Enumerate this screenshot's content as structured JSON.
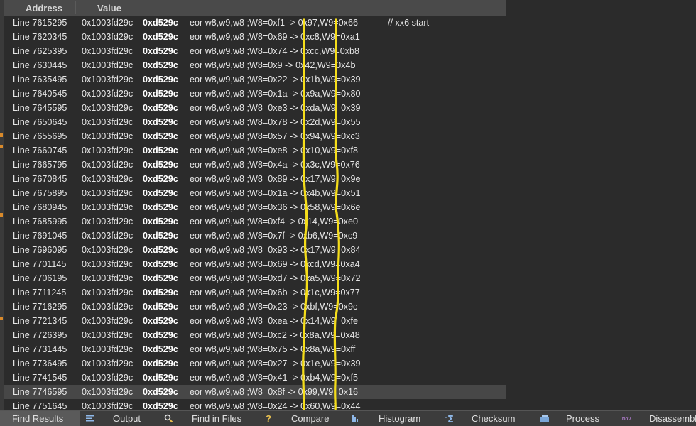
{
  "columns": {
    "address": "Address",
    "value": "Value"
  },
  "rows": [
    {
      "line": "Line 7615295",
      "addr": "0x1003fd29c",
      "val": "0xd529c",
      "ins": "eor w8,w9,w8 ;W8=0xf1 -> 0x97,W9=0x66",
      "comment": "// xx6 start"
    },
    {
      "line": "Line 7620345",
      "addr": "0x1003fd29c",
      "val": "0xd529c",
      "ins": "eor w8,w9,w8 ;W8=0x69 -> 0xc8,W9=0xa1",
      "comment": ""
    },
    {
      "line": "Line 7625395",
      "addr": "0x1003fd29c",
      "val": "0xd529c",
      "ins": "eor w8,w9,w8 ;W8=0x74 -> 0xcc,W9=0xb8",
      "comment": ""
    },
    {
      "line": "Line 7630445",
      "addr": "0x1003fd29c",
      "val": "0xd529c",
      "ins": "eor w8,w9,w8 ;W8=0x9 -> 0x42,W9=0x4b",
      "comment": ""
    },
    {
      "line": "Line 7635495",
      "addr": "0x1003fd29c",
      "val": "0xd529c",
      "ins": "eor w8,w9,w8 ;W8=0x22 -> 0x1b,W9=0x39",
      "comment": ""
    },
    {
      "line": "Line 7640545",
      "addr": "0x1003fd29c",
      "val": "0xd529c",
      "ins": "eor w8,w9,w8 ;W8=0x1a -> 0x9a,W9=0x80",
      "comment": ""
    },
    {
      "line": "Line 7645595",
      "addr": "0x1003fd29c",
      "val": "0xd529c",
      "ins": "eor w8,w9,w8 ;W8=0xe3 -> 0xda,W9=0x39",
      "comment": ""
    },
    {
      "line": "Line 7650645",
      "addr": "0x1003fd29c",
      "val": "0xd529c",
      "ins": "eor w8,w9,w8 ;W8=0x78 -> 0x2d,W9=0x55",
      "comment": ""
    },
    {
      "line": "Line 7655695",
      "addr": "0x1003fd29c",
      "val": "0xd529c",
      "ins": "eor w8,w9,w8 ;W8=0x57 -> 0x94,W9=0xc3",
      "comment": ""
    },
    {
      "line": "Line 7660745",
      "addr": "0x1003fd29c",
      "val": "0xd529c",
      "ins": "eor w8,w9,w8 ;W8=0xe8 -> 0x10,W9=0xf8",
      "comment": ""
    },
    {
      "line": "Line 7665795",
      "addr": "0x1003fd29c",
      "val": "0xd529c",
      "ins": "eor w8,w9,w8 ;W8=0x4a -> 0x3c,W9=0x76",
      "comment": ""
    },
    {
      "line": "Line 7670845",
      "addr": "0x1003fd29c",
      "val": "0xd529c",
      "ins": "eor w8,w9,w8 ;W8=0x89 -> 0x17,W9=0x9e",
      "comment": ""
    },
    {
      "line": "Line 7675895",
      "addr": "0x1003fd29c",
      "val": "0xd529c",
      "ins": "eor w8,w9,w8 ;W8=0x1a -> 0x4b,W9=0x51",
      "comment": ""
    },
    {
      "line": "Line 7680945",
      "addr": "0x1003fd29c",
      "val": "0xd529c",
      "ins": "eor w8,w9,w8 ;W8=0x36 -> 0x58,W9=0x6e",
      "comment": ""
    },
    {
      "line": "Line 7685995",
      "addr": "0x1003fd29c",
      "val": "0xd529c",
      "ins": "eor w8,w9,w8 ;W8=0xf4 -> 0x14,W9=0xe0",
      "comment": ""
    },
    {
      "line": "Line 7691045",
      "addr": "0x1003fd29c",
      "val": "0xd529c",
      "ins": "eor w8,w9,w8 ;W8=0x7f -> 0xb6,W9=0xc9",
      "comment": ""
    },
    {
      "line": "Line 7696095",
      "addr": "0x1003fd29c",
      "val": "0xd529c",
      "ins": "eor w8,w9,w8 ;W8=0x93 -> 0x17,W9=0x84",
      "comment": ""
    },
    {
      "line": "Line 7701145",
      "addr": "0x1003fd29c",
      "val": "0xd529c",
      "ins": "eor w8,w9,w8 ;W8=0x69 -> 0xcd,W9=0xa4",
      "comment": ""
    },
    {
      "line": "Line 7706195",
      "addr": "0x1003fd29c",
      "val": "0xd529c",
      "ins": "eor w8,w9,w8 ;W8=0xd7 -> 0xa5,W9=0x72",
      "comment": ""
    },
    {
      "line": "Line 7711245",
      "addr": "0x1003fd29c",
      "val": "0xd529c",
      "ins": "eor w8,w9,w8 ;W8=0x6b -> 0x1c,W9=0x77",
      "comment": ""
    },
    {
      "line": "Line 7716295",
      "addr": "0x1003fd29c",
      "val": "0xd529c",
      "ins": "eor w8,w9,w8 ;W8=0x23 -> 0xbf,W9=0x9c",
      "comment": ""
    },
    {
      "line": "Line 7721345",
      "addr": "0x1003fd29c",
      "val": "0xd529c",
      "ins": "eor w8,w9,w8 ;W8=0xea -> 0x14,W9=0xfe",
      "comment": ""
    },
    {
      "line": "Line 7726395",
      "addr": "0x1003fd29c",
      "val": "0xd529c",
      "ins": "eor w8,w9,w8 ;W8=0xc2 -> 0x8a,W9=0x48",
      "comment": ""
    },
    {
      "line": "Line 7731445",
      "addr": "0x1003fd29c",
      "val": "0xd529c",
      "ins": "eor w8,w9,w8 ;W8=0x75 -> 0x8a,W9=0xff",
      "comment": ""
    },
    {
      "line": "Line 7736495",
      "addr": "0x1003fd29c",
      "val": "0xd529c",
      "ins": "eor w8,w9,w8 ;W8=0x27 -> 0x1e,W9=0x39",
      "comment": ""
    },
    {
      "line": "Line 7741545",
      "addr": "0x1003fd29c",
      "val": "0xd529c",
      "ins": "eor w8,w9,w8 ;W8=0x41 -> 0xb4,W9=0xf5",
      "comment": ""
    },
    {
      "line": "Line 7746595",
      "addr": "0x1003fd29c",
      "val": "0xd529c",
      "ins": "eor w8,w9,w8 ;W8=0x8f -> 0x99,W9=0x16",
      "comment": ""
    },
    {
      "line": "Line 7751645",
      "addr": "0x1003fd29c",
      "val": "0xd529c",
      "ins": "eor w8,w9,w8 ;W8=0x24 -> 0x60,W9=0x44",
      "comment": ""
    }
  ],
  "selected_row": 26,
  "tabs": [
    {
      "label": "Find Results",
      "icon": "find-results"
    },
    {
      "label": "Output",
      "icon": "output-icon"
    },
    {
      "label": "Find in Files",
      "icon": "find-in-files-icon"
    },
    {
      "label": "Compare",
      "icon": "compare-icon"
    },
    {
      "label": "Histogram",
      "icon": "histogram-icon"
    },
    {
      "label": "Checksum",
      "icon": "checksum-icon"
    },
    {
      "label": "Process",
      "icon": "process-icon"
    },
    {
      "label": "Disassembly",
      "icon": "disassembly-icon"
    }
  ],
  "colors": {
    "annotation": "#f5dd1a",
    "background": "#2b2b2b",
    "selected_row": "#474747"
  }
}
